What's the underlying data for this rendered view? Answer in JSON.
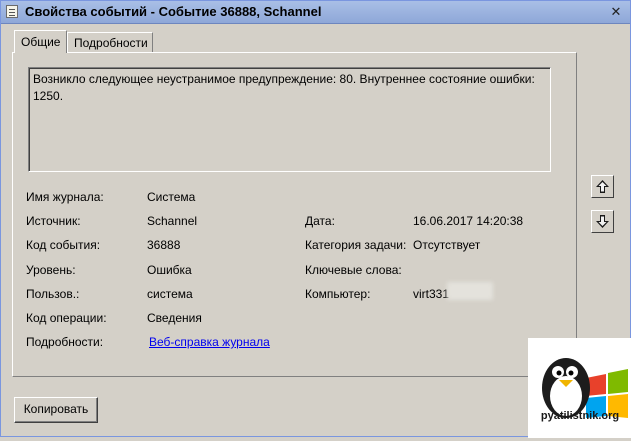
{
  "window": {
    "title": "Свойства событий - Событие 36888, Schannel",
    "close_glyph": "✕"
  },
  "tabs": [
    {
      "label": "Общие"
    },
    {
      "label": "Подробности"
    }
  ],
  "message": "Возникло следующее неустранимое предупреждение: 80. Внутреннее состояние ошибки: 1250.",
  "fields": {
    "log_name": {
      "label": "Имя журнала:",
      "value": "Система"
    },
    "source": {
      "label": "Источник:",
      "value": "Schannel"
    },
    "event_id": {
      "label": "Код события:",
      "value": "36888"
    },
    "level": {
      "label": "Уровень:",
      "value": "Ошибка"
    },
    "user": {
      "label": "Пользов.:",
      "value": "система"
    },
    "opcode": {
      "label": "Код операции:",
      "value": "Сведения"
    },
    "more_info": {
      "label": "Подробности:",
      "value": "Веб-справка журнала"
    },
    "date": {
      "label": "Дата:",
      "value": "16.06.2017 14:20:38"
    },
    "task_category": {
      "label": "Категория задачи:",
      "value": "Отсутствует"
    },
    "keywords": {
      "label": "Ключевые слова:",
      "value": ""
    },
    "computer": {
      "label": "Компьютер:",
      "value": "virt331"
    }
  },
  "buttons": {
    "copy_label": "Копировать",
    "up_icon": "arrow-up-icon",
    "down_icon": "arrow-down-icon"
  },
  "watermark": {
    "text": "pyatilistnik.org"
  }
}
